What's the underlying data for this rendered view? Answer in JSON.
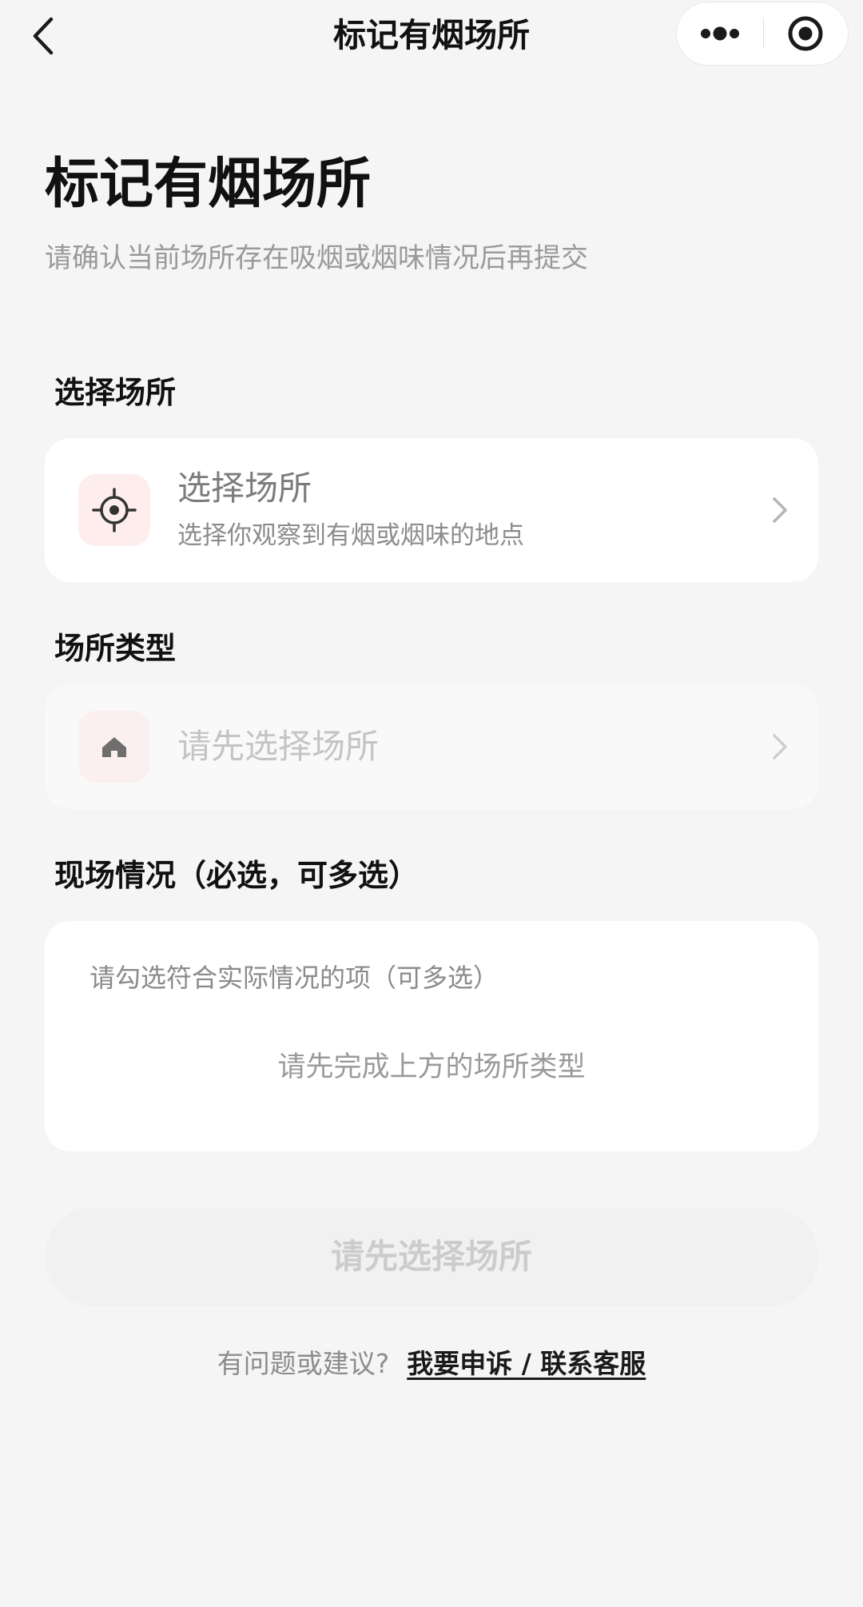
{
  "nav": {
    "title": "标记有烟场所",
    "back_icon": "chevron-left-icon",
    "more_icon": "more-dots-icon",
    "close_icon": "target-close-icon"
  },
  "header": {
    "title": "标记有烟场所",
    "subtitle": "请确认当前场所存在吸烟或烟味情况后再提交"
  },
  "location_section": {
    "label": "选择场所",
    "card": {
      "icon": "crosshair-icon",
      "title": "选择场所",
      "subtitle": "选择你观察到有烟或烟味的地点"
    }
  },
  "type_section": {
    "label": "场所类型",
    "card": {
      "icon": "home-icon",
      "placeholder": "请先选择场所",
      "disabled": true
    }
  },
  "condition_section": {
    "label": "现场情况（必选，可多选）",
    "hint": "请勾选符合实际情况的项（可多选）",
    "empty_text": "请先完成上方的场所类型"
  },
  "submit": {
    "label": "请先选择场所",
    "disabled": true
  },
  "footer": {
    "question": "有问题或建议?",
    "link": "我要申诉 / 联系客服"
  },
  "colors": {
    "background": "#f5f5f5",
    "card": "#ffffff",
    "icon_bg": "#fdeeed",
    "muted_text": "#9a9a9a",
    "disabled_button": "#f1f1f1"
  }
}
